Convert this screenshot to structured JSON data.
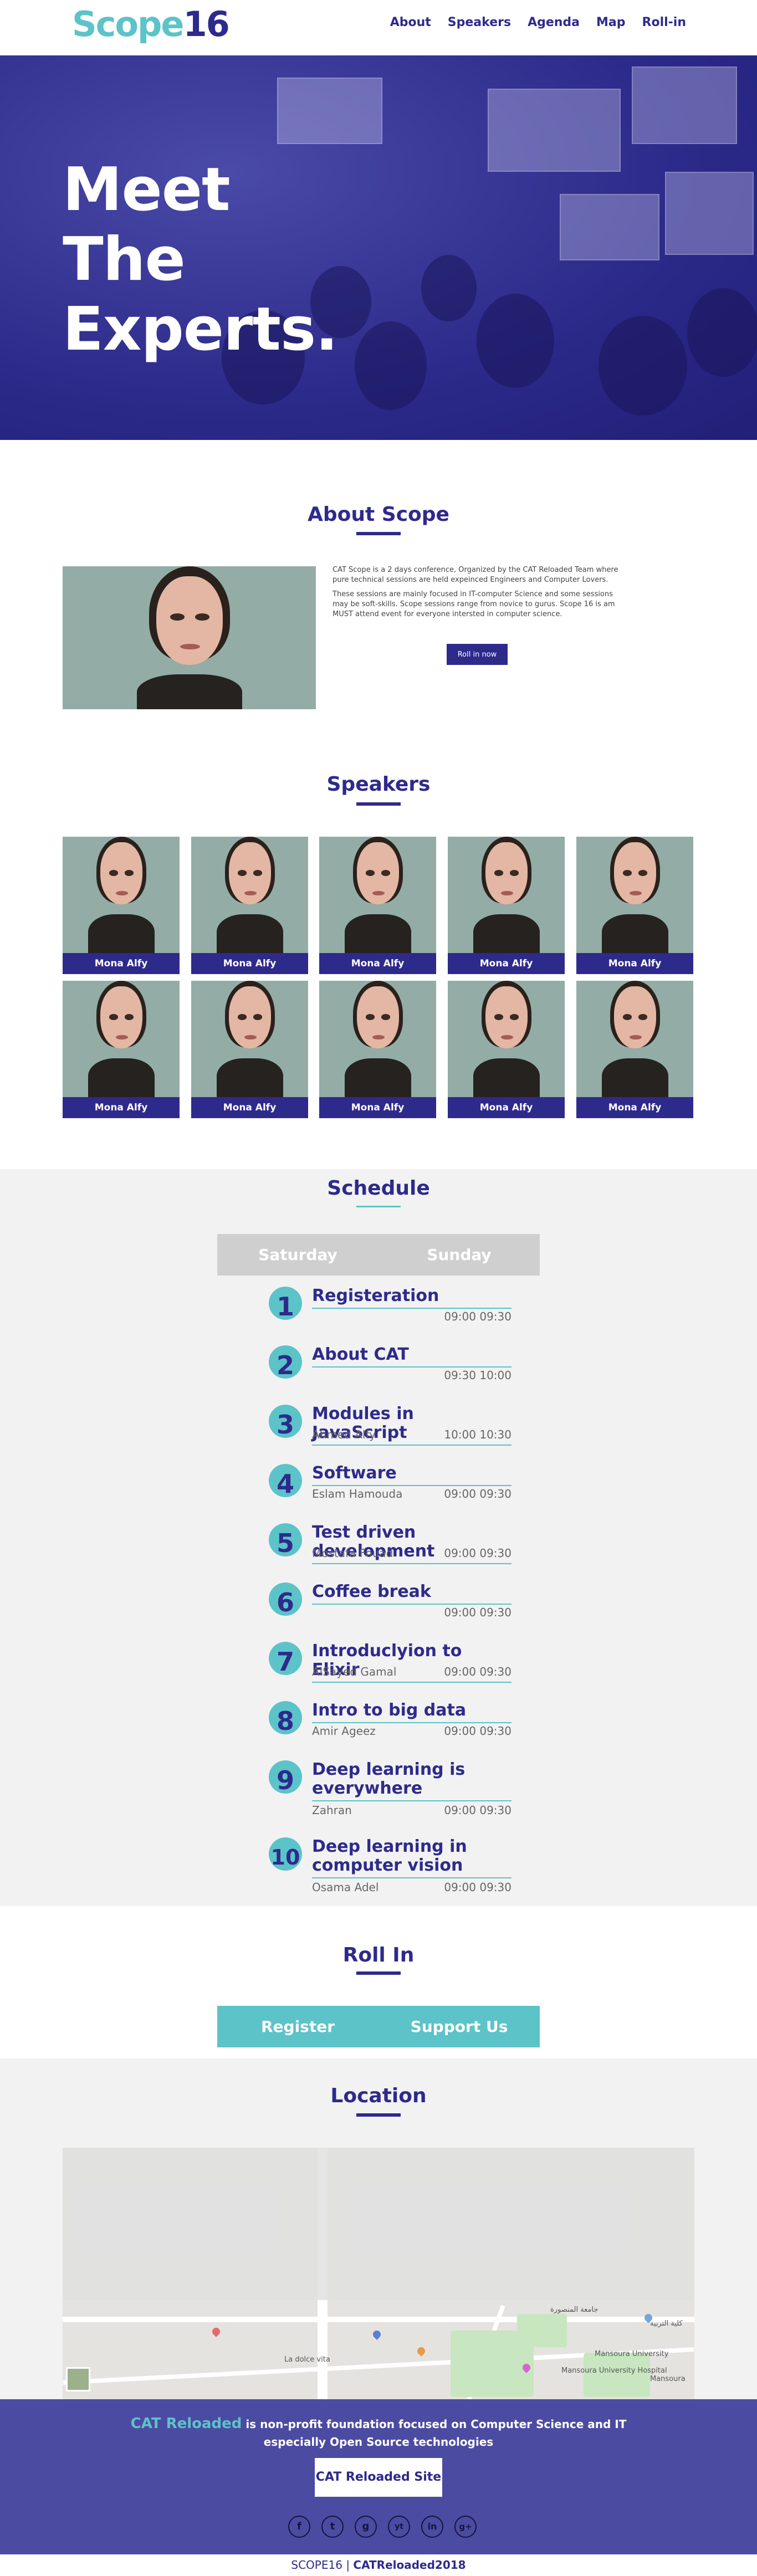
{
  "nav": {
    "logo_a": "Scope",
    "logo_b": "16",
    "links": [
      "About",
      "Speakers",
      "Agenda",
      "Map",
      "Roll-in"
    ]
  },
  "hero": {
    "line1": "Meet",
    "line2": "The",
    "line3": "Experts."
  },
  "about": {
    "title": "About Scope",
    "p1": "CAT Scope is a 2 days conference, Organized by the CAT Reloaded Team where pure technical sessions are held expeinced Engineers and Computer Lovers.",
    "p2": "These sessions are mainly focused in IT-computer Science and some sessions may be soft-skills. Scope sessions range from novice to gurus. Scope 16 is am MUST attend event for everyone intersted in computer science.",
    "button": "Roll in now"
  },
  "speakers": {
    "title": "Speakers",
    "names": [
      "Mona Alfy",
      "Mona Alfy",
      "Mona Alfy",
      "Mona Alfy",
      "Mona Alfy",
      "Mona Alfy",
      "Mona Alfy",
      "Mona Alfy",
      "Mona Alfy",
      "Mona Alfy"
    ]
  },
  "schedule": {
    "title": "Schedule",
    "days": [
      "Saturday",
      "Sunday"
    ],
    "items": [
      {
        "num": "1",
        "title": "Registeration",
        "speaker": "",
        "time": "09:00 09:30"
      },
      {
        "num": "2",
        "title": "About CAT",
        "speaker": "",
        "time": "09:30 10:00"
      },
      {
        "num": "3",
        "title": "Modules in JavaScript",
        "speaker": "Ahmed Alfy",
        "time": "10:00 10:30"
      },
      {
        "num": "4",
        "title": "Software",
        "speaker": "Eslam Hamouda",
        "time": "09:00 09:30"
      },
      {
        "num": "5",
        "title": "Test driven development",
        "speaker": "Mostafa Fouad",
        "time": "09:00 09:30"
      },
      {
        "num": "6",
        "title": "Coffee break",
        "speaker": "",
        "time": "09:00 09:30"
      },
      {
        "num": "7",
        "title": "Introduclyion to Elixir",
        "speaker": "AlSayed Gamal",
        "time": "09:00 09:30"
      },
      {
        "num": "8",
        "title": "Intro to big data",
        "speaker": "Amir Ageez",
        "time": "09:00 09:30"
      },
      {
        "num": "9",
        "title": "Deep learning is everywhere",
        "speaker": "Zahran",
        "time": "09:00 09:30"
      },
      {
        "num": "10",
        "title": "Deep learning in computer vision",
        "speaker": "Osama Adel",
        "time": "09:00 09:30"
      }
    ]
  },
  "rollin": {
    "title": "Roll In",
    "register": "Register",
    "support": "Support Us"
  },
  "location": {
    "title": "Location",
    "map_labels": [
      "جامعة المنصورة",
      "كلية التربية",
      "Mansoura University",
      "Mansoura",
      "La dolce vita",
      "Mansoura University Hospital"
    ]
  },
  "footer": {
    "brand": "CAT Reloaded",
    "text1": " is non-profit foundation focused on Computer Science and IT",
    "text2": "especially Open Source technologies",
    "button": "CAT Reloaded Site",
    "socials": [
      "f",
      "t",
      "g",
      "yt",
      "in",
      "g+"
    ],
    "social_icons": [
      "facebook-icon",
      "twitter-icon",
      "github-icon",
      "youtube-icon",
      "linkedin-icon",
      "google-plus-icon"
    ],
    "copy_a": "SCOPE16",
    "copy_sep": "|",
    "copy_b": "CATReloaded2018"
  }
}
